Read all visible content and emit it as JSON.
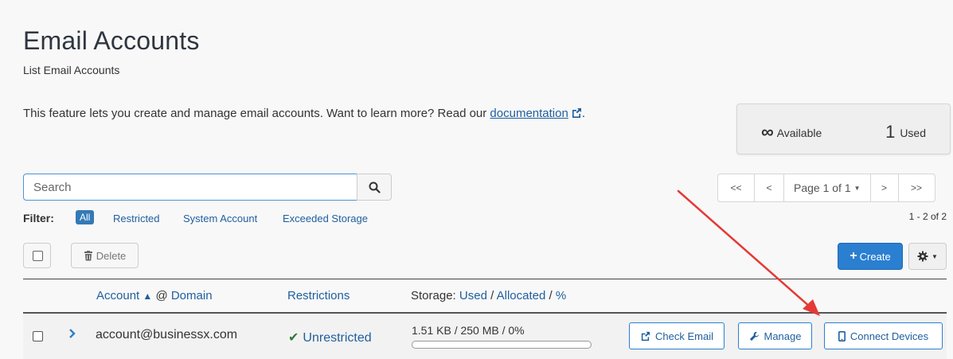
{
  "page": {
    "title": "Email Accounts",
    "subtitle": "List Email Accounts",
    "intro_text": "This feature lets you create and manage email accounts. Want to learn more? Read our ",
    "intro_link": "documentation",
    "intro_end": "."
  },
  "stats": {
    "available_symbol": "∞",
    "available_label": "Available",
    "used_count": "1",
    "used_label": "Used"
  },
  "search": {
    "placeholder": "Search"
  },
  "filter": {
    "label": "Filter:",
    "options": [
      "All",
      "Restricted",
      "System Account",
      "Exceeded Storage"
    ],
    "active": "All"
  },
  "pagination": {
    "first": "<<",
    "prev": "<",
    "page_label": "Page 1 of 1",
    "next": ">",
    "last": ">>",
    "count_text": "1 - 2 of 2"
  },
  "toolbar": {
    "delete_label": "Delete",
    "create_label": "Create"
  },
  "table": {
    "headers": {
      "account": "Account",
      "at": "@",
      "domain": "Domain",
      "restrictions": "Restrictions",
      "storage_prefix": "Storage:",
      "used": "Used",
      "slash1": "/",
      "allocated": "Allocated",
      "slash2": "/",
      "percent": "%"
    },
    "rows": [
      {
        "account": "account@businessx.com",
        "restriction": "Unrestricted",
        "storage": "1.51 KB / 250 MB / 0%",
        "usage_percent": 0,
        "actions": [
          "Check Email",
          "Manage",
          "Connect Devices"
        ]
      }
    ]
  },
  "colors": {
    "accent": "#2b7fd0",
    "link": "#1f5f9e",
    "success": "#2f7d32",
    "annotation_arrow": "#e53935"
  }
}
